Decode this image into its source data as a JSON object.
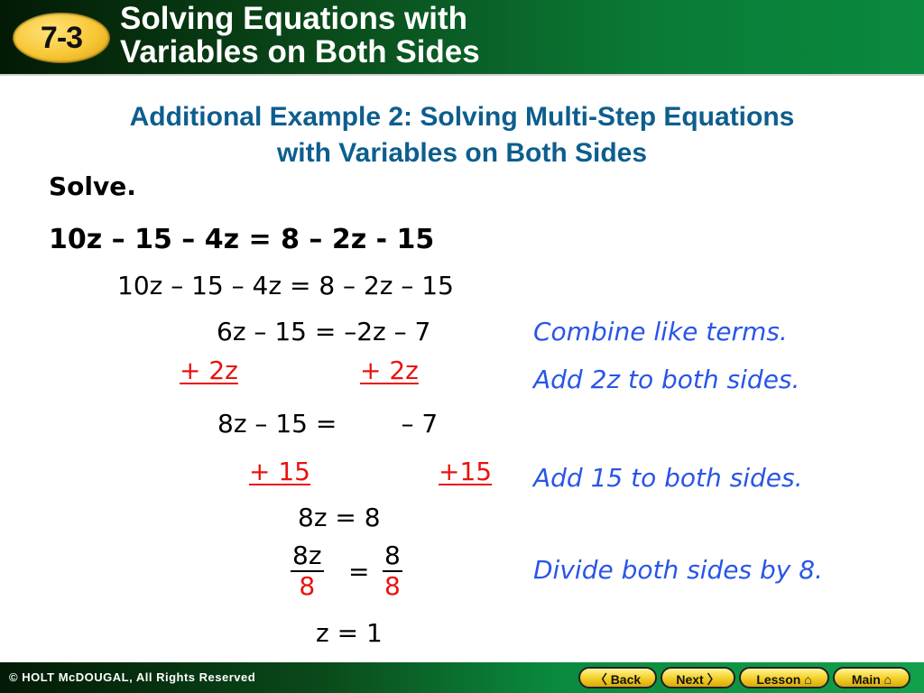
{
  "header": {
    "lesson_number": "7-3",
    "title_line1": "Solving Equations with",
    "title_line2": "Variables on Both Sides"
  },
  "subtitle": {
    "line1": "Additional Example 2: Solving Multi-Step Equations",
    "line2": "with Variables on Both Sides"
  },
  "problem": {
    "prompt": "Solve.",
    "equation": "10z – 15 – 4z = 8 – 2z - 15"
  },
  "steps": {
    "rewrite": "10z – 15 – 4z = 8 – 2z – 15",
    "combined": "6z – 15 = –2z – 7",
    "add_left": "+ 2z",
    "add_right": "+ 2z",
    "after_add": "8z – 15 =        – 7",
    "add15_left": "+ 15",
    "add15_right": "+15",
    "simplified": "8z = 8",
    "frac_left_num": "8z",
    "frac_left_den": "8",
    "frac_equals": "=",
    "frac_right_num": "8",
    "frac_right_den": "8",
    "solution": "z = 1"
  },
  "notes": {
    "combine": "Combine like terms.",
    "add_2z": "Add 2z to both sides.",
    "add_15": "Add 15 to both sides.",
    "divide": "Divide both sides by 8."
  },
  "footer": {
    "copyright": "© HOLT McDOUGAL, All Rights Reserved",
    "back": "〈 Back",
    "next": "Next 〉",
    "lesson": "Lesson ⌂",
    "main": "Main ⌂"
  },
  "colors": {
    "subtitle": "#0d5e8e",
    "note": "#2a55e6",
    "added_terms": "#e8130f",
    "badge": "#f7c634"
  }
}
